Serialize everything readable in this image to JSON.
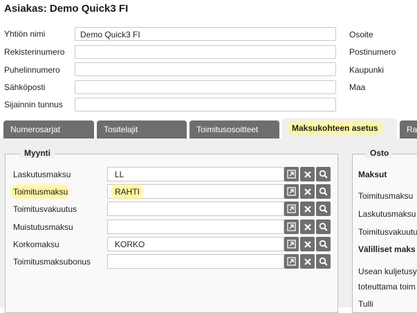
{
  "title": "Asiakas: Demo Quick3 FI",
  "form": {
    "fields": [
      {
        "label": "Yhtiön nimi",
        "value": "Demo Quick3 FI"
      },
      {
        "label": "Rekisterinumero",
        "value": ""
      },
      {
        "label": "Puhelinnumero",
        "value": ""
      },
      {
        "label": "Sähköposti",
        "value": ""
      },
      {
        "label": "Sijainnin tunnus",
        "value": ""
      }
    ],
    "right_labels": [
      "Osoite",
      "Postinumero",
      "Kaupunki",
      "Maa"
    ]
  },
  "tabs": [
    {
      "label": "Numerosarjat",
      "active": false
    },
    {
      "label": "Tositelajit",
      "active": false
    },
    {
      "label": "Toimitusosoitteet",
      "active": false
    },
    {
      "label": "Maksukohteen asetus",
      "active": true
    },
    {
      "label": "Ra",
      "active": false
    }
  ],
  "myynti": {
    "legend": "Myynti",
    "rows": [
      {
        "label": "Laskutusmaksu",
        "value": "LL"
      },
      {
        "label": "Toimitusmaksu",
        "value": "RAHTI",
        "highlighted": true
      },
      {
        "label": "Toimitusvakuutus",
        "value": ""
      },
      {
        "label": "Muistutusmaksu",
        "value": ""
      },
      {
        "label": "Korkomaksu",
        "value": "KORKO"
      },
      {
        "label": "Toimitusmaksubonus",
        "value": ""
      }
    ]
  },
  "osto": {
    "legend": "Osto",
    "lines": [
      {
        "text": "Maksut",
        "bold": true
      },
      {
        "text": "Toimitusmaksu",
        "bold": false
      },
      {
        "text": "Laskutusmaksu",
        "bold": false
      },
      {
        "text": "Toimitusvakuutu",
        "bold": false
      },
      {
        "text": "Välilliset maks",
        "bold": true
      },
      {
        "text": "Usean kuljetusy",
        "bold": false
      },
      {
        "text": "toteuttama toim",
        "bold": false
      },
      {
        "text": "Tulli",
        "bold": false
      }
    ]
  },
  "buttons": {
    "icons": [
      "open-icon",
      "close-icon",
      "search-icon"
    ],
    "color": "#6f6f6f"
  },
  "colors": {
    "tab_inactive": "#6e6e6e",
    "highlight": "#fdf5a0"
  }
}
